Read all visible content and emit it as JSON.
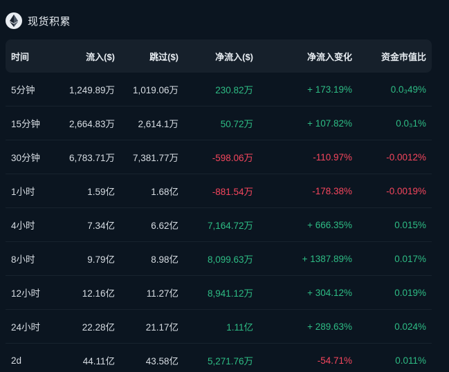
{
  "header": {
    "icon": "ethereum-icon",
    "title": "现货积累"
  },
  "colors": {
    "positive": "#2ebd85",
    "negative": "#f6465d",
    "neutral": "#d7dde3"
  },
  "table": {
    "columns": [
      "时间",
      "流入($)",
      "跳过($)",
      "净流入($)",
      "净流入变化",
      "资金市值比"
    ],
    "rows": [
      {
        "time": "5分钟",
        "inflow": "1,249.89万",
        "skip": "1,019.06万",
        "net": "230.82万",
        "net_sign": "pos",
        "change": "+ 173.19%",
        "change_sign": "pos",
        "ratio": "0.0₃49%",
        "ratio_sign": "pos"
      },
      {
        "time": "15分钟",
        "inflow": "2,664.83万",
        "skip": "2,614.1万",
        "net": "50.72万",
        "net_sign": "pos",
        "change": "+ 107.82%",
        "change_sign": "pos",
        "ratio": "0.0₃1%",
        "ratio_sign": "pos"
      },
      {
        "time": "30分钟",
        "inflow": "6,783.71万",
        "skip": "7,381.77万",
        "net": "-598.06万",
        "net_sign": "neg",
        "change": "-110.97%",
        "change_sign": "neg",
        "ratio": "-0.0012%",
        "ratio_sign": "neg"
      },
      {
        "time": "1小时",
        "inflow": "1.59亿",
        "skip": "1.68亿",
        "net": "-881.54万",
        "net_sign": "neg",
        "change": "-178.38%",
        "change_sign": "neg",
        "ratio": "-0.0019%",
        "ratio_sign": "neg"
      },
      {
        "time": "4小时",
        "inflow": "7.34亿",
        "skip": "6.62亿",
        "net": "7,164.72万",
        "net_sign": "pos",
        "change": "+ 666.35%",
        "change_sign": "pos",
        "ratio": "0.015%",
        "ratio_sign": "pos"
      },
      {
        "time": "8小时",
        "inflow": "9.79亿",
        "skip": "8.98亿",
        "net": "8,099.63万",
        "net_sign": "pos",
        "change": "+ 1387.89%",
        "change_sign": "pos",
        "ratio": "0.017%",
        "ratio_sign": "pos"
      },
      {
        "time": "12小时",
        "inflow": "12.16亿",
        "skip": "11.27亿",
        "net": "8,941.12万",
        "net_sign": "pos",
        "change": "+ 304.12%",
        "change_sign": "pos",
        "ratio": "0.019%",
        "ratio_sign": "pos"
      },
      {
        "time": "24小时",
        "inflow": "22.28亿",
        "skip": "21.17亿",
        "net": "1.11亿",
        "net_sign": "pos",
        "change": "+ 289.63%",
        "change_sign": "pos",
        "ratio": "0.024%",
        "ratio_sign": "pos"
      },
      {
        "time": "2d",
        "inflow": "44.11亿",
        "skip": "43.58亿",
        "net": "5,271.76万",
        "net_sign": "pos",
        "change": "-54.71%",
        "change_sign": "neg",
        "ratio": "0.011%",
        "ratio_sign": "pos"
      }
    ]
  }
}
